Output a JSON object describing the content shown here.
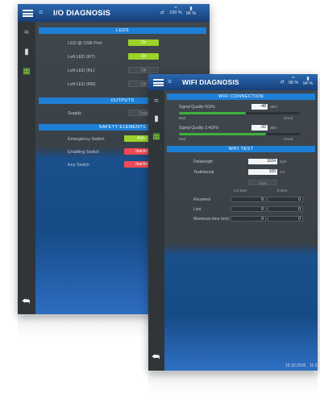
{
  "io_window": {
    "title": "I/O DIAGNOSIS",
    "status": {
      "net": "⇄",
      "wifi": "100 %",
      "battery": "96 %"
    },
    "leds": {
      "header": "LEDS",
      "rows": [
        {
          "label": "LED @ USB Port",
          "button": "On",
          "state": "on"
        },
        {
          "label": "Left LED (RT)",
          "button": "On",
          "state": "on"
        },
        {
          "label": "Left LED (RL)",
          "button": "Off",
          "state": "off"
        },
        {
          "label": "Left LED (RR)",
          "button": "Off",
          "state": "off"
        }
      ]
    },
    "outputs": {
      "header": "OUTPUTS",
      "rows": [
        {
          "label": "Supply",
          "button": "Toggl",
          "state": "off"
        }
      ]
    },
    "safety": {
      "header": "SAFETY ELEMENTS",
      "rows": [
        {
          "label": "Emergency Switch",
          "button": "Activ",
          "state": "on"
        },
        {
          "label": "Enabling Switch",
          "button": "Inactiv",
          "state": "alarm"
        },
        {
          "label": "Key Switch",
          "button": "Inactiv",
          "state": "alarm"
        }
      ]
    }
  },
  "wifi_window": {
    "title": "WIFI DIAGNOSIS",
    "status": {
      "net": "⇄",
      "wifi": "98 %",
      "battery": "94 %"
    },
    "connection": {
      "header": "WIFI CONNECTION",
      "signals": [
        {
          "label": "Signal Quality 5GHz",
          "value": "-48",
          "unit": "dBm",
          "level": 0.55,
          "min_label": "Bad",
          "max_label": "Good"
        },
        {
          "label": "Signal Quality 2.4GHz",
          "value": "-32",
          "unit": "dBm",
          "level": 0.72,
          "min_label": "Bad",
          "max_label": "Good"
        }
      ]
    },
    "test": {
      "header": "WIFI TEST",
      "datalength": {
        "label": "Datalength",
        "value": "1024",
        "unit": "byte"
      },
      "testinterval": {
        "label": "Testinterval",
        "value": "100",
        "unit": "ms"
      },
      "start_label": "Start",
      "columns": [
        "2.4 GHz",
        "5 GHz"
      ],
      "rows": [
        {
          "label": "Received",
          "values": [
            "0",
            "0"
          ]
        },
        {
          "label": "Lost",
          "values": [
            "0",
            "0"
          ]
        },
        {
          "label": "Maximum time (ms)",
          "values": [
            "0",
            "0"
          ]
        }
      ]
    },
    "footer": {
      "date": "16.10.2018",
      "time": "11:3"
    }
  },
  "icons": [
    "menu-icon",
    "logo-icon",
    "network-icon",
    "wifi-icon",
    "battery-icon",
    "handset-icon",
    "io-module-icon",
    "back-arrow-icon"
  ],
  "colors": {
    "accent_blue": "#1e7fd6",
    "led_on": "#9bd32a",
    "alarm_red": "#f04a56",
    "signal_green": "#3cb23c"
  }
}
